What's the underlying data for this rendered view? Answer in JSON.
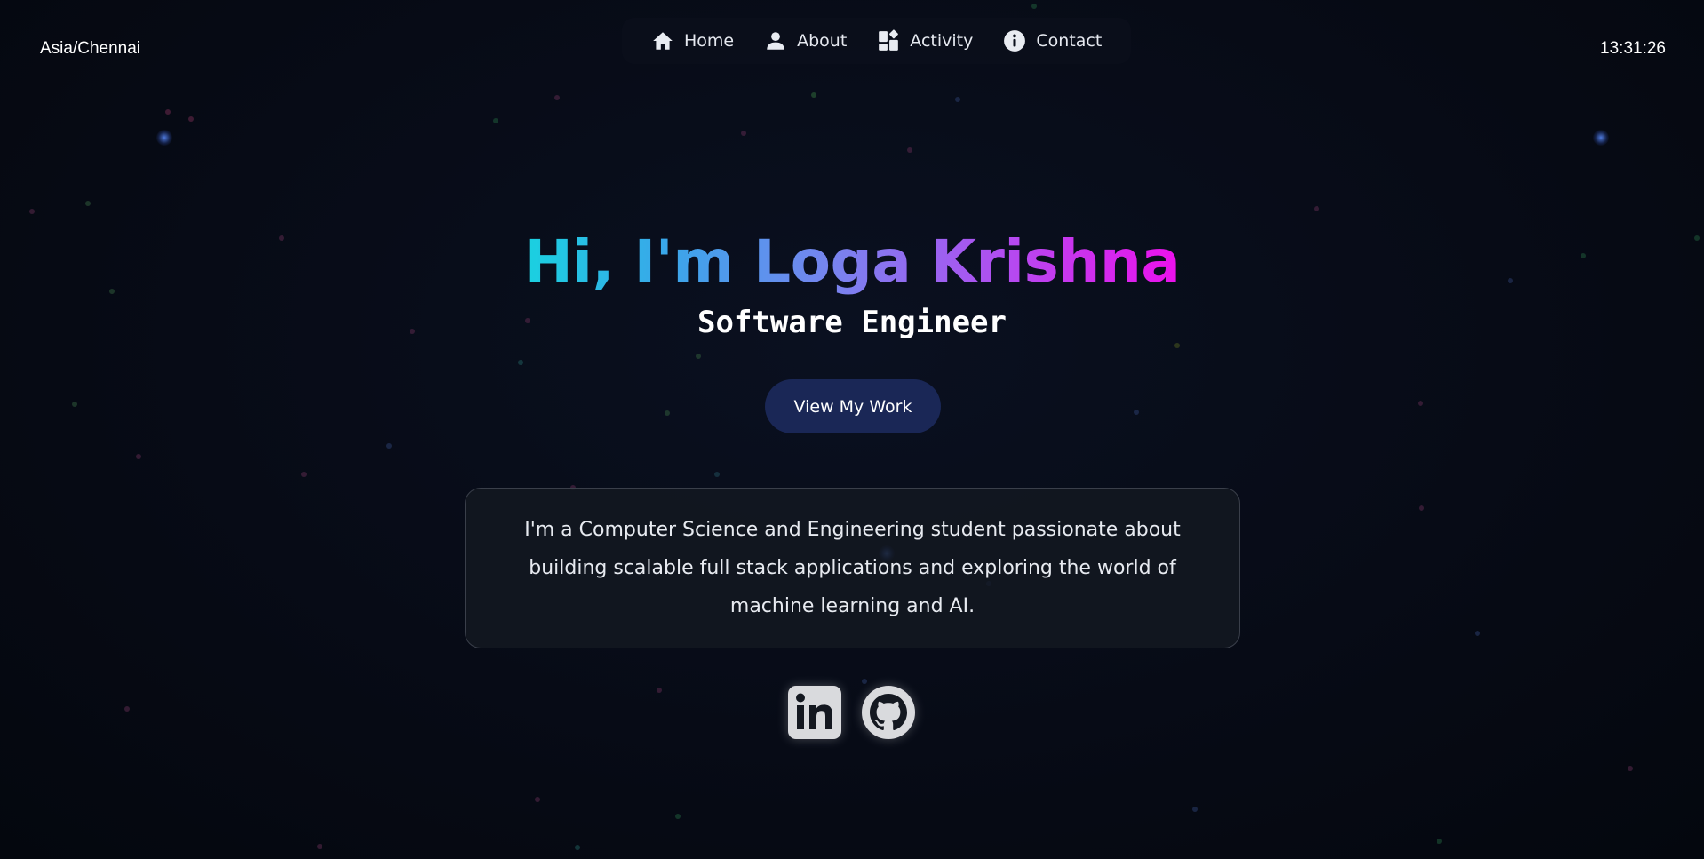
{
  "header": {
    "timezone": "Asia/Chennai",
    "time": "13:31:26"
  },
  "nav": {
    "items": [
      {
        "label": "Home",
        "icon": "home-icon"
      },
      {
        "label": "About",
        "icon": "user-icon"
      },
      {
        "label": "Activity",
        "icon": "dashboard-icon"
      },
      {
        "label": "Contact",
        "icon": "info-icon"
      }
    ]
  },
  "hero": {
    "title": "Hi, I'm Loga Krishna",
    "role": "Software Engineer",
    "cta_label": "View My Work"
  },
  "about": {
    "text": "I'm a Computer Science and Engineering student passionate about building scalable full stack applications and exploring the world of machine learning and AI."
  },
  "socials": [
    {
      "icon": "linkedin-icon"
    },
    {
      "icon": "github-icon"
    }
  ],
  "colors": {
    "background": "#05080f",
    "gradient_start": "#1ad1e0",
    "gradient_end": "#ec10ec",
    "button": "#1a2756"
  }
}
